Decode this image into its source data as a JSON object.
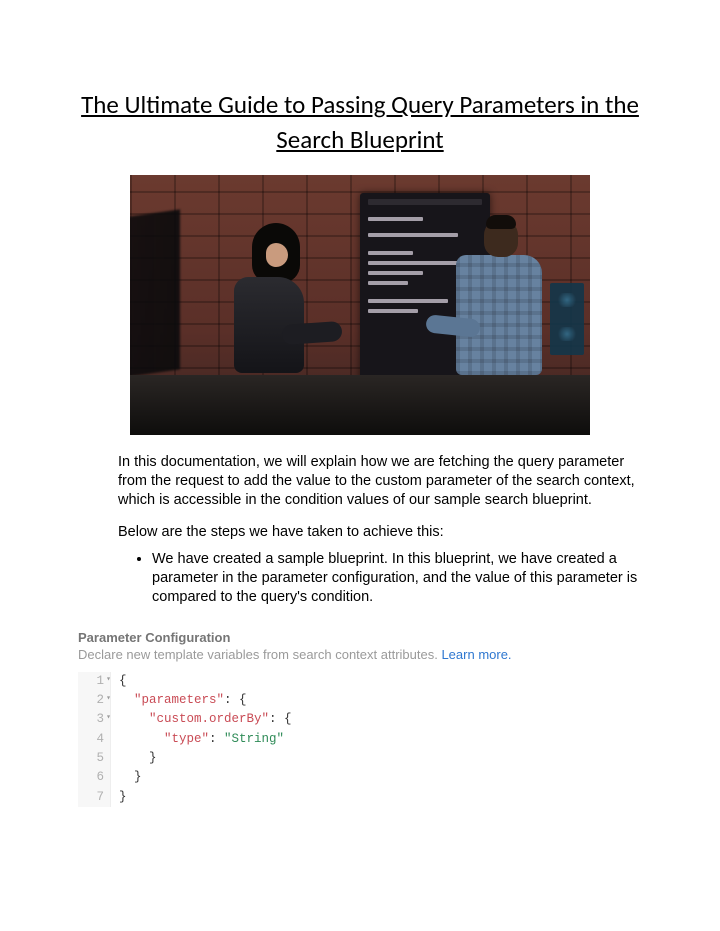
{
  "title": "The Ultimate Guide to Passing Query Parameters in the Search Blueprint",
  "intro": "In this documentation, we will explain how we are fetching the query parameter from the request to add the value to the custom parameter of the search context, which is accessible in the condition values of our sample search blueprint.",
  "steps_lead": "Below are the steps we have taken to achieve this:",
  "bullet_1": "We have created a sample blueprint. In this blueprint, we have created a parameter in the parameter configuration, and the value of this parameter is compared to the query's condition.",
  "config": {
    "heading": "Parameter Configuration",
    "subtext": "Declare new template variables from search context attributes. ",
    "learn_more": "Learn more."
  },
  "code": {
    "lines": {
      "1": {
        "num": "1",
        "pre": "",
        "text": "{",
        "cls": "brace",
        "fold": "▾"
      },
      "2": {
        "num": "2",
        "pre": "  ",
        "key": "\"parameters\"",
        "suffix": ": {",
        "fold": "▾"
      },
      "3": {
        "num": "3",
        "pre": "    ",
        "key": "\"custom.orderBy\"",
        "suffix": ": {",
        "fold": "▾"
      },
      "4": {
        "num": "4",
        "pre": "      ",
        "key": "\"type\"",
        "mid": ": ",
        "val": "\"String\""
      },
      "5": {
        "num": "5",
        "pre": "    ",
        "text": "}",
        "cls": "brace"
      },
      "6": {
        "num": "6",
        "pre": "  ",
        "text": "}",
        "cls": "brace"
      },
      "7": {
        "num": "7",
        "pre": "",
        "text": "}",
        "cls": "brace"
      }
    }
  }
}
